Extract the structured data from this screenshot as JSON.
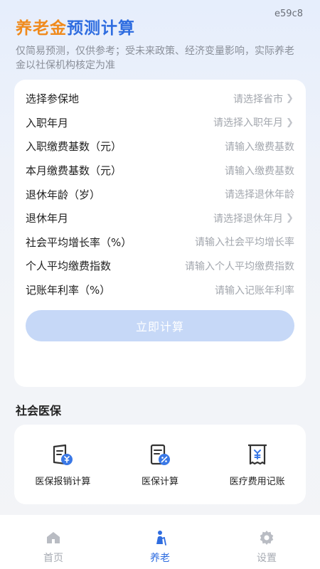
{
  "tag": "e59c8",
  "header": {
    "title_part1": "养老金",
    "title_part2": "预测计算",
    "subtitle": "仅简易预测，仅供参考；受未来政策、经济变量影响，实际养老金以社保机构核定为准"
  },
  "form": {
    "rows": [
      {
        "label": "选择参保地",
        "placeholder": "请选择省市",
        "chevron": true
      },
      {
        "label": "入职年月",
        "placeholder": "请选择入职年月",
        "chevron": true
      },
      {
        "label": "入职缴费基数（元）",
        "placeholder": "请输入缴费基数",
        "chevron": false
      },
      {
        "label": "本月缴费基数（元）",
        "placeholder": "请输入缴费基数",
        "chevron": false
      },
      {
        "label": "退休年龄（岁）",
        "placeholder": "请选择退休年龄",
        "chevron": false
      },
      {
        "label": "退休年月",
        "placeholder": "请选择退休年月",
        "chevron": true
      },
      {
        "label": "社会平均增长率（%）",
        "placeholder": "请输入社会平均增长率",
        "chevron": false
      },
      {
        "label": "个人平均缴费指数",
        "placeholder": "请输入个人平均缴费指数",
        "chevron": false
      },
      {
        "label": "记账年利率（%）",
        "placeholder": "请输入记账年利率",
        "chevron": false
      }
    ],
    "submit_label": "立即计算"
  },
  "medical": {
    "section_title": "社会医保",
    "items": [
      {
        "label": "医保报销计算",
        "icon": "shield-yuan-icon"
      },
      {
        "label": "医保计算",
        "icon": "document-percent-icon"
      },
      {
        "label": "医疗费用记账",
        "icon": "receipt-yuan-icon"
      }
    ]
  },
  "tabbar": {
    "tabs": [
      {
        "label": "首页",
        "icon": "home-icon",
        "active": false
      },
      {
        "label": "养老",
        "icon": "elderly-icon",
        "active": true
      },
      {
        "label": "设置",
        "icon": "gear-icon",
        "active": false
      }
    ]
  },
  "colors": {
    "orange": "#f08a1c",
    "blue": "#2f6de0",
    "button_disabled": "#c6d8f7"
  }
}
